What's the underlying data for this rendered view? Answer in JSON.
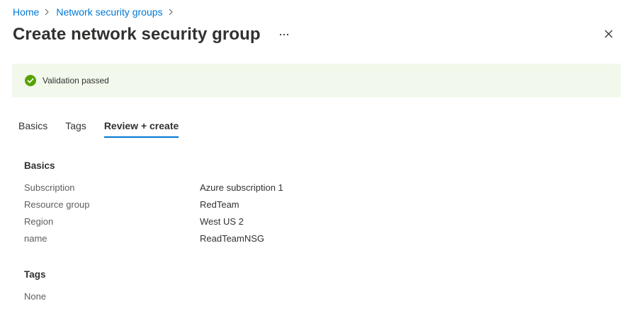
{
  "breadcrumb": {
    "home": "Home",
    "parent": "Network security groups"
  },
  "header": {
    "title": "Create network security group",
    "more_icon": "ellipsis-icon",
    "close_icon": "close-icon"
  },
  "banner": {
    "message": "Validation passed",
    "icon": "check-circle-icon",
    "background": "#f2f9ec",
    "icon_color": "#57a300"
  },
  "tabs": [
    {
      "label": "Basics",
      "active": false
    },
    {
      "label": "Tags",
      "active": false
    },
    {
      "label": "Review + create",
      "active": true
    }
  ],
  "accent_color": "#0078d4",
  "review": {
    "basics": {
      "heading": "Basics",
      "rows": [
        {
          "label": "Subscription",
          "value": "Azure subscription 1"
        },
        {
          "label": "Resource group",
          "value": "RedTeam"
        },
        {
          "label": "Region",
          "value": "West US 2"
        },
        {
          "label": "name",
          "value": "ReadTeamNSG"
        }
      ]
    },
    "tags": {
      "heading": "Tags",
      "value": "None"
    }
  }
}
